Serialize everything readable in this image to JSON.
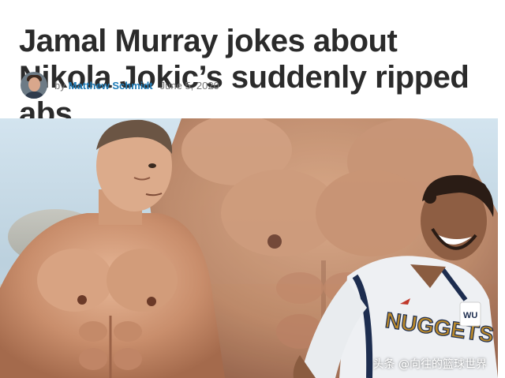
{
  "article": {
    "headline": "Jamal Murray jokes about Nikola Jokic’s suddenly ripped abs",
    "byline_prefix": "by",
    "author": "Matthew Schmidt",
    "date": "June 5, 2020"
  },
  "image": {
    "jersey_text": "NUGGETS",
    "sponsor_patch": "WU",
    "watermark": "头条 @向往的篮球世界"
  },
  "colors": {
    "author_link": "#1f7bb6",
    "headline": "#2b2b2b",
    "jersey_gold": "#b8882b",
    "jersey_navy": "#1d2d4f"
  }
}
